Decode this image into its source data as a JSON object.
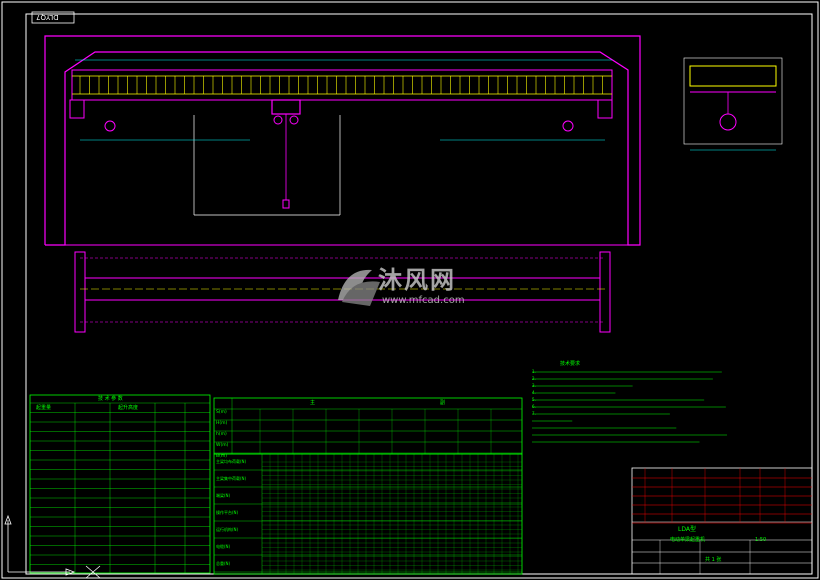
{
  "drawing": {
    "code_stamp": "DLYQ7",
    "background_color": "#000000",
    "colors": {
      "frame": "#ffffff",
      "structure": "#ff00ff",
      "dimension": "#00ffff",
      "text": "#00ff00",
      "detail": "#ffff00",
      "title_block": "#ff0000"
    }
  },
  "params": {
    "header": "技 术 参 数",
    "col_headers": [
      "起重量",
      "起升高度"
    ]
  },
  "span_table": {
    "row_labels": [
      "S(m)",
      "H(m)",
      "h(m)",
      "W(m)",
      "B(m)"
    ],
    "group_headers": [
      "主",
      "副"
    ]
  },
  "load_table": {
    "row_labels": [
      "主梁均布荷载(N)",
      "主梁集中荷载(N)",
      "端梁(N)",
      "操作平台(N)",
      "运行机构(N)",
      "电缆(N)",
      "总重(N)"
    ]
  },
  "notes": {
    "title": "技术要求",
    "items": [
      "1.",
      "2.",
      "3.",
      "4.",
      "5.",
      "6.",
      "7."
    ]
  },
  "title_block": {
    "drawing_title": "LDA型",
    "drawing_subtitle": "电动单梁起重机",
    "scale": "1:50",
    "sheet": "共 1 张"
  },
  "watermark": {
    "brand": "沐风网",
    "url": "www.mfcad.com"
  }
}
